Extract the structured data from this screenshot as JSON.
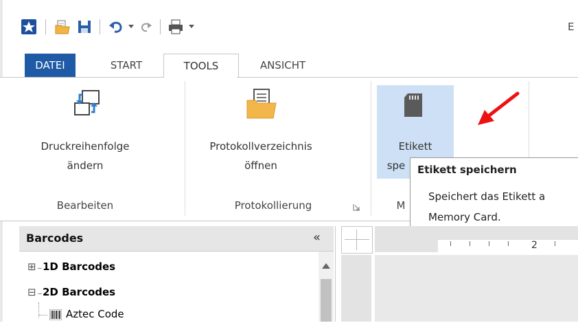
{
  "qat": {
    "icons": [
      "app-star-icon",
      "open-folder-icon",
      "save-icon",
      "undo-icon",
      "undo-dropdown-icon",
      "redo-icon",
      "print-icon",
      "customize-dropdown-icon"
    ],
    "title_partial": "E"
  },
  "tabs": [
    {
      "label": "DATEI"
    },
    {
      "label": "START"
    },
    {
      "label": "TOOLS"
    },
    {
      "label": "ANSICHT"
    }
  ],
  "ribbon": {
    "buttons": {
      "print_order": {
        "line1": "Druckreihenfolge",
        "line2": "ändern"
      },
      "log_dir": {
        "line1": "Protokollverzeichnis",
        "line2": "öffnen"
      },
      "save_label": {
        "line1": "Etikett",
        "line2_partial": "spe"
      }
    },
    "groups": {
      "edit": "Bearbeiten",
      "logging": "Protokollierung",
      "memory_partial": "M"
    }
  },
  "tooltip": {
    "title": "Etikett speichern",
    "line1": "Speichert das Etikett a",
    "line2": "Memory Card."
  },
  "panel": {
    "title": "Barcodes",
    "collapse_glyph": "«",
    "tree": [
      {
        "toggle": "⊞",
        "label": "1D Barcodes"
      },
      {
        "toggle": "⊟",
        "label": "2D Barcodes"
      },
      {
        "label": "Aztec Code"
      }
    ]
  },
  "ruler": {
    "mark": "2"
  },
  "colors": {
    "accent": "#1e5aa5",
    "hover": "#cde0f5",
    "arrow": "#ee1111"
  }
}
